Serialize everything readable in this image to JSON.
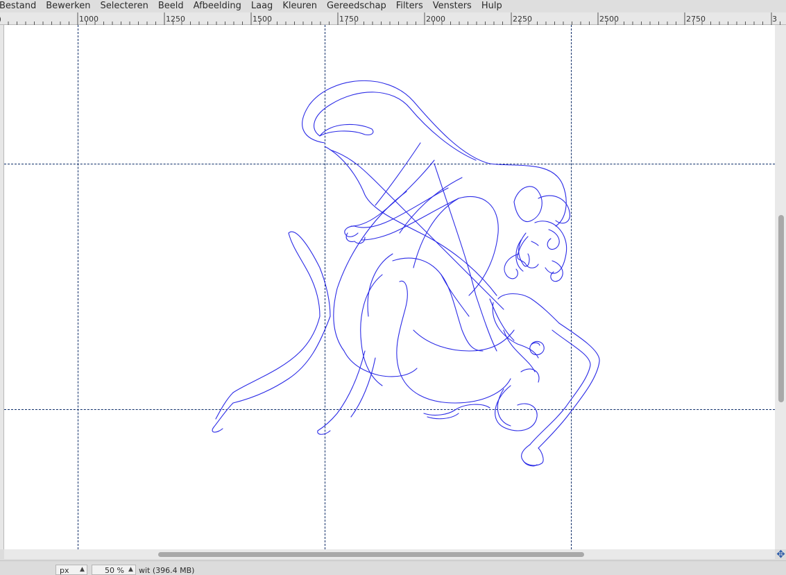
{
  "menubar": {
    "items": [
      "Bestand",
      "Bewerken",
      "Selecteren",
      "Beeld",
      "Afbeelding",
      "Laag",
      "Kleuren",
      "Gereedschap",
      "Filters",
      "Vensters",
      "Hulp"
    ]
  },
  "ruler": {
    "labels": [
      "1000",
      "1250",
      "1500",
      "1750",
      "2000",
      "2250",
      "2500",
      "2750",
      "3"
    ]
  },
  "statusbar": {
    "unit": "px",
    "zoom": "50 %",
    "image_info": "wit (396.4 MB)"
  },
  "colors": {
    "line_art": "#2a2ae6",
    "guides": "#0a2a66",
    "canvas": "#ffffff"
  },
  "icons": {
    "navigate": "navigate-icon"
  }
}
